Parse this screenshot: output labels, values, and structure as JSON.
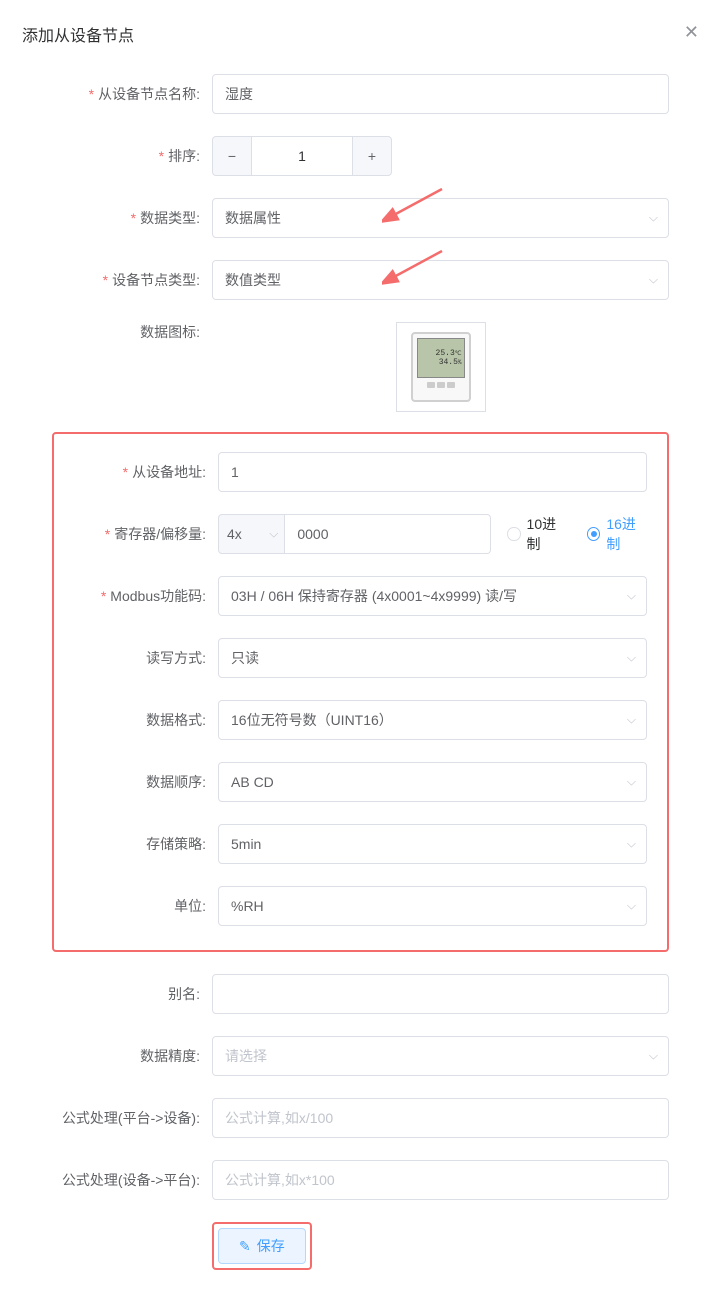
{
  "modal": {
    "title": "添加从设备节点"
  },
  "labels": {
    "node_name": "从设备节点名称:",
    "sort": "排序:",
    "data_type": "数据类型:",
    "device_node_type": "设备节点类型:",
    "data_icon": "数据图标:",
    "slave_addr": "从设备地址:",
    "register_offset": "寄存器/偏移量:",
    "modbus_func": "Modbus功能码:",
    "read_write": "读写方式:",
    "data_format": "数据格式:",
    "data_order": "数据顺序:",
    "storage_policy": "存储策略:",
    "unit": "单位:",
    "alias": "别名:",
    "data_precision": "数据精度:",
    "formula_to_device": "公式处理(平台->设备):",
    "formula_to_platform": "公式处理(设备->平台):"
  },
  "values": {
    "node_name": "湿度",
    "sort": "1",
    "data_type": "数据属性",
    "device_node_type": "数值类型",
    "slave_addr": "1",
    "register_prefix": "4x",
    "register_value": "0000",
    "modbus_func": "03H / 06H 保持寄存器 (4x0001~4x9999) 读/写",
    "read_write": "只读",
    "data_format": "16位无符号数（UINT16）",
    "data_order": "AB CD",
    "storage_policy": "5min",
    "unit": "%RH",
    "alias": "",
    "data_precision_placeholder": "请选择",
    "formula_to_device_placeholder": "公式计算,如x/100",
    "formula_to_platform_placeholder": "公式计算,如x*100"
  },
  "radio": {
    "decimal": "10进制",
    "hex": "16进制"
  },
  "save_label": "保存",
  "icon_display": {
    "temp": "25.3",
    "humid": "34.5"
  }
}
